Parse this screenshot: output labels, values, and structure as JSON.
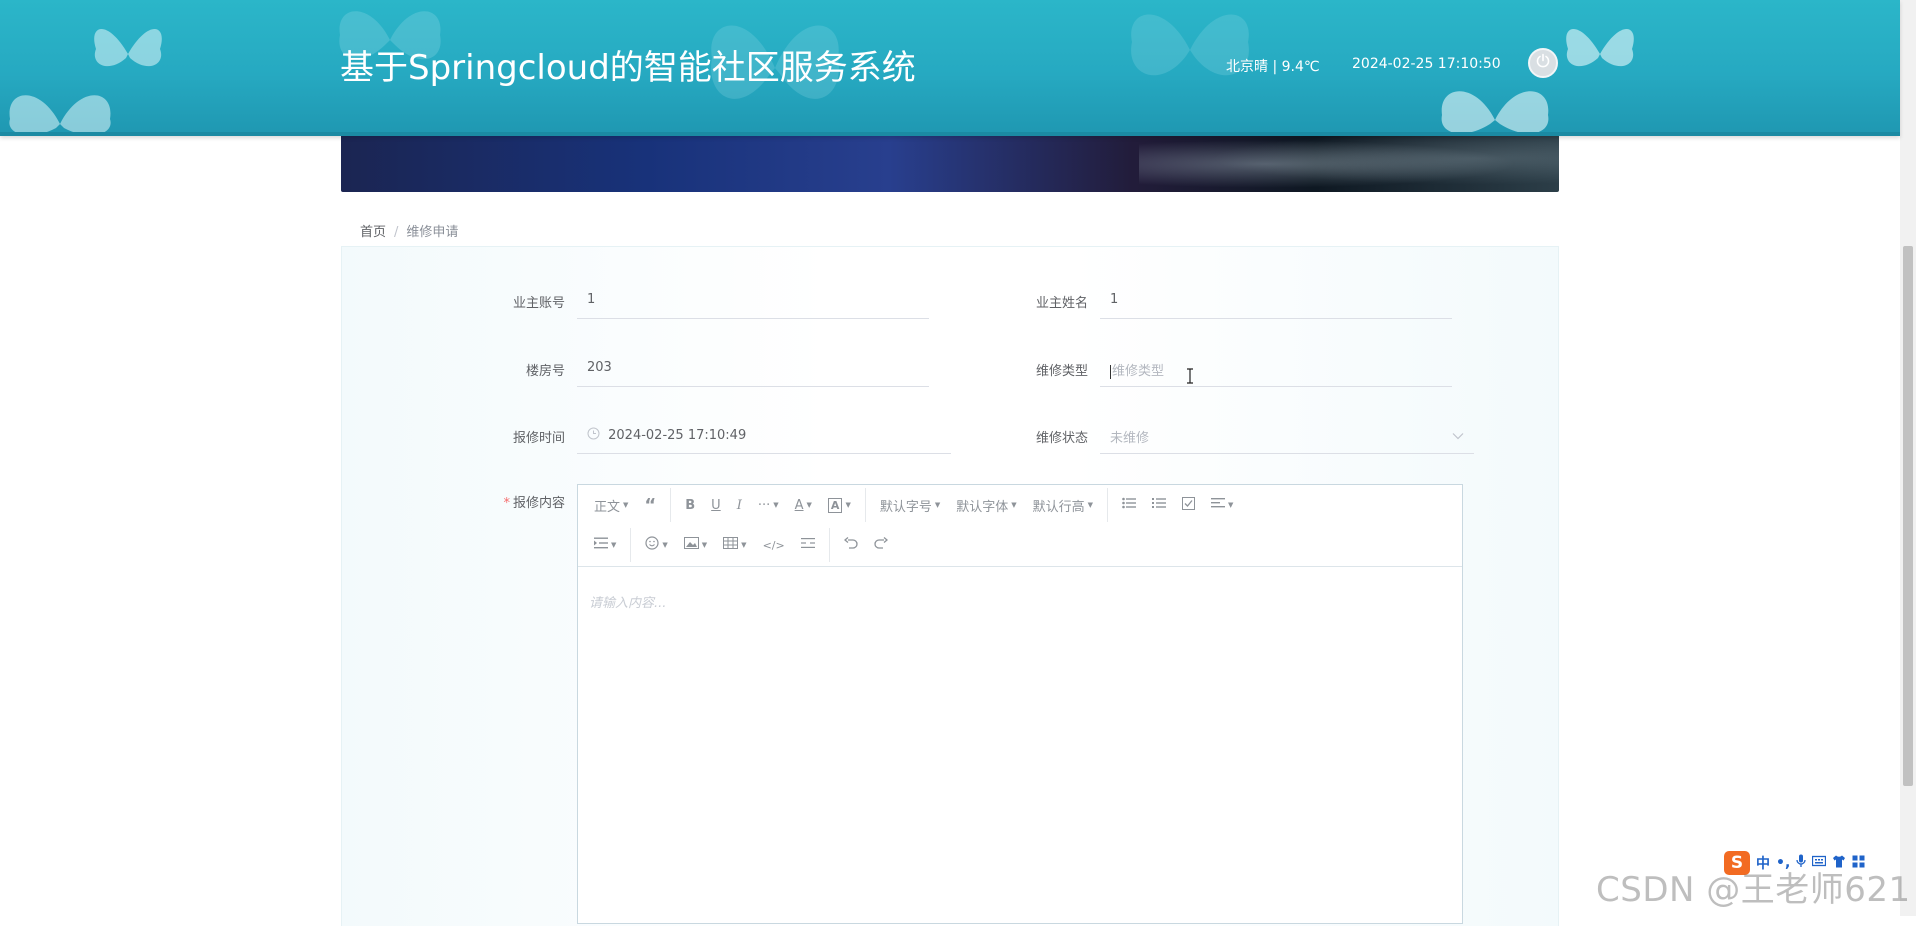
{
  "header": {
    "title": "基于Springcloud的智能社区服务系统",
    "weather": "北京晴 | 9.4℃",
    "datetime": "2024-02-25   17:10:50",
    "logout_icon": "power-icon"
  },
  "breadcrumb": {
    "home": "首页",
    "separator": "/",
    "current": "维修申请"
  },
  "form": {
    "owner_account": {
      "label": "业主账号",
      "value": "1"
    },
    "owner_name": {
      "label": "业主姓名",
      "value": "1"
    },
    "building_no": {
      "label": "楼房号",
      "value": "203"
    },
    "repair_type": {
      "label": "维修类型",
      "placeholder": "维修类型"
    },
    "report_time": {
      "label": "报修时间",
      "value": "2024-02-25 17:10:49"
    },
    "repair_status": {
      "label": "维修状态",
      "value": "未维修"
    },
    "content": {
      "label": "报修内容",
      "required_mark": "*",
      "placeholder": "请输入内容..."
    }
  },
  "editor_toolbar": {
    "row1": {
      "paragraph": "正文",
      "font_size": "默认字号",
      "font_family": "默认字体",
      "line_height": "默认行高"
    }
  },
  "ime": {
    "logo": "S",
    "lang": "中",
    "items": [
      "•,",
      "mic-icon",
      "keyboard-icon",
      "shirt-icon",
      "grid-icon"
    ]
  },
  "watermark": "CSDN @王老师621",
  "colors": {
    "header": "#26a9c1",
    "required": "#f56c6c",
    "text": "#606266",
    "placeholder": "#b3b7bf"
  }
}
